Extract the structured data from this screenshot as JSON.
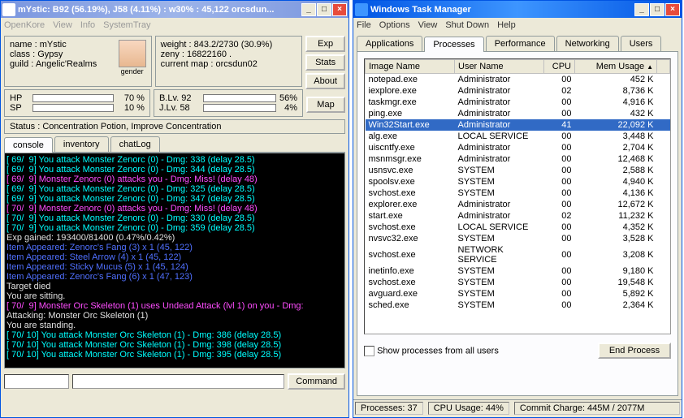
{
  "kore": {
    "title": "mYstic:  B92 (56.19%), J58 (4.11%) : w30% : 45,122 orcsdun...",
    "menu": [
      "OpenKore",
      "View",
      "Info",
      "SystemTray"
    ],
    "name_label": "name :",
    "name": "mYstic",
    "class_label": "class :",
    "class": "Gypsy",
    "guild_label": "guild :",
    "guild": "Angelic'Realms",
    "gender_label": "gender",
    "weight_label": "weight :",
    "weight": "843.2/2730 (30.9%)",
    "zeny_label": "zeny :",
    "zeny": "16822160 .",
    "map_label": "current map :",
    "map": "orcsdun02",
    "hp_label": "HP",
    "hp_pct": "70 %",
    "hp_fill": 70,
    "sp_label": "SP",
    "sp_pct": "10 %",
    "sp_fill": 10,
    "blv_label": "B.Lv. 92",
    "blv_pct": "56%",
    "blv_fill": 56,
    "jlv_label": "J.Lv. 58",
    "jlv_pct": "4%",
    "jlv_fill": 4,
    "status_label": "Status :",
    "status": "Concentration Potion, Improve Concentration",
    "btns": {
      "exp": "Exp",
      "stats": "Stats",
      "about": "About",
      "map": "Map"
    },
    "tabs": [
      "console",
      "inventory",
      "chatLog"
    ],
    "command_btn": "Command",
    "console_lines": [
      {
        "c": "cyan",
        "t": "[ 69/  9] You attack Monster Zenorc (0) - Dmg: 338 (delay 28.5)"
      },
      {
        "c": "cyan",
        "t": "[ 69/  9] You attack Monster Zenorc (0) - Dmg: 344 (delay 28.5)"
      },
      {
        "c": "magenta",
        "t": "[ 69/  9] Monster Zenorc (0) attacks you - Dmg: Miss! (delay 48)"
      },
      {
        "c": "cyan",
        "t": "[ 69/  9] You attack Monster Zenorc (0) - Dmg: 325 (delay 28.5)"
      },
      {
        "c": "cyan",
        "t": "[ 69/  9] You attack Monster Zenorc (0) - Dmg: 347 (delay 28.5)"
      },
      {
        "c": "magenta",
        "t": "[ 70/  9] Monster Zenorc (0) attacks you - Dmg: Miss! (delay 48)"
      },
      {
        "c": "cyan",
        "t": "[ 70/  9] You attack Monster Zenorc (0) - Dmg: 330 (delay 28.5)"
      },
      {
        "c": "cyan",
        "t": "[ 70/  9] You attack Monster Zenorc (0) - Dmg: 359 (delay 28.5)"
      },
      {
        "c": "white",
        "t": "Exp gained: 193400/81400 (0.47%/0.42%)"
      },
      {
        "c": "blue",
        "t": "Item Appeared: Zenorc's Fang (3) x 1 (45, 122)"
      },
      {
        "c": "blue",
        "t": "Item Appeared: Steel Arrow (4) x 1 (45, 122)"
      },
      {
        "c": "blue",
        "t": "Item Appeared: Sticky Mucus (5) x 1 (45, 124)"
      },
      {
        "c": "blue",
        "t": "Item Appeared: Zenorc's Fang (6) x 1 (47, 123)"
      },
      {
        "c": "white",
        "t": "Target died"
      },
      {
        "c": "white",
        "t": "You are sitting."
      },
      {
        "c": "magenta",
        "t": "[ 70/  9] Monster Orc Skeleton (1) uses Undead Attack (lvl 1) on you - Dmg:"
      },
      {
        "c": "white",
        "t": "Attacking: Monster Orc Skeleton (1)"
      },
      {
        "c": "white",
        "t": "You are standing."
      },
      {
        "c": "cyan",
        "t": "[ 70/ 10] You attack Monster Orc Skeleton (1) - Dmg: 386 (delay 28.5)"
      },
      {
        "c": "cyan",
        "t": "[ 70/ 10] You attack Monster Orc Skeleton (1) - Dmg: 398 (delay 28.5)"
      },
      {
        "c": "cyan",
        "t": "[ 70/ 10] You attack Monster Orc Skeleton (1) - Dmg: 395 (delay 28.5)"
      }
    ]
  },
  "taskmgr": {
    "title": "Windows Task Manager",
    "menu": [
      "File",
      "Options",
      "View",
      "Shut Down",
      "Help"
    ],
    "tabs": [
      "Applications",
      "Processes",
      "Performance",
      "Networking",
      "Users"
    ],
    "headers": [
      "Image Name",
      "User Name",
      "CPU",
      "Mem Usage"
    ],
    "rows": [
      {
        "img": "notepad.exe",
        "user": "Administrator",
        "cpu": "00",
        "mem": "452 K"
      },
      {
        "img": "iexplore.exe",
        "user": "Administrator",
        "cpu": "02",
        "mem": "8,736 K"
      },
      {
        "img": "taskmgr.exe",
        "user": "Administrator",
        "cpu": "00",
        "mem": "4,916 K"
      },
      {
        "img": "ping.exe",
        "user": "Administrator",
        "cpu": "00",
        "mem": "432 K"
      },
      {
        "img": "Win32Start.exe",
        "user": "Administrator",
        "cpu": "41",
        "mem": "22,092 K",
        "sel": true
      },
      {
        "img": "alg.exe",
        "user": "LOCAL SERVICE",
        "cpu": "00",
        "mem": "3,448 K"
      },
      {
        "img": "uiscntfy.exe",
        "user": "Administrator",
        "cpu": "00",
        "mem": "2,704 K"
      },
      {
        "img": "msnmsgr.exe",
        "user": "Administrator",
        "cpu": "00",
        "mem": "12,468 K"
      },
      {
        "img": "usnsvc.exe",
        "user": "SYSTEM",
        "cpu": "00",
        "mem": "2,588 K"
      },
      {
        "img": "spoolsv.exe",
        "user": "SYSTEM",
        "cpu": "00",
        "mem": "4,940 K"
      },
      {
        "img": "svchost.exe",
        "user": "SYSTEM",
        "cpu": "00",
        "mem": "4,136 K"
      },
      {
        "img": "explorer.exe",
        "user": "Administrator",
        "cpu": "00",
        "mem": "12,672 K"
      },
      {
        "img": "start.exe",
        "user": "Administrator",
        "cpu": "02",
        "mem": "11,232 K"
      },
      {
        "img": "svchost.exe",
        "user": "LOCAL SERVICE",
        "cpu": "00",
        "mem": "4,352 K"
      },
      {
        "img": "nvsvc32.exe",
        "user": "SYSTEM",
        "cpu": "00",
        "mem": "3,528 K"
      },
      {
        "img": "svchost.exe",
        "user": "NETWORK SERVICE",
        "cpu": "00",
        "mem": "3,208 K"
      },
      {
        "img": "inetinfo.exe",
        "user": "SYSTEM",
        "cpu": "00",
        "mem": "9,180 K"
      },
      {
        "img": "svchost.exe",
        "user": "SYSTEM",
        "cpu": "00",
        "mem": "19,548 K"
      },
      {
        "img": "avguard.exe",
        "user": "SYSTEM",
        "cpu": "00",
        "mem": "5,892 K"
      },
      {
        "img": "sched.exe",
        "user": "SYSTEM",
        "cpu": "00",
        "mem": "2,364 K"
      }
    ],
    "show_all": "Show processes from all users",
    "end_process": "End Process",
    "status": {
      "procs": "Processes: 37",
      "cpu": "CPU Usage: 44%",
      "commit": "Commit Charge: 445M / 2077M"
    }
  }
}
